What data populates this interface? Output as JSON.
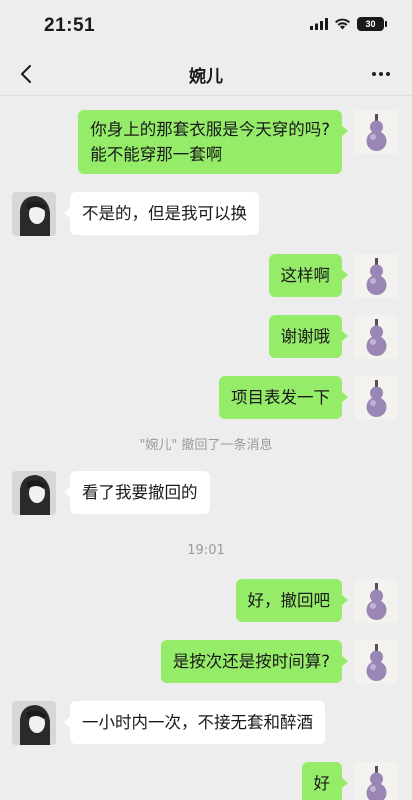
{
  "status_bar": {
    "time": "21:51",
    "battery": "30"
  },
  "header": {
    "title": "婉儿",
    "back_icon": "chevron-left-icon",
    "more_icon": "more-dots-icon"
  },
  "messages": [
    {
      "sender": "self",
      "text_lines": [
        "你身上的那套衣服是今天穿的吗?",
        "能不能穿那一套啊"
      ]
    },
    {
      "sender": "other",
      "text": "不是的，但是我可以换"
    },
    {
      "sender": "self",
      "text": "这样啊"
    },
    {
      "sender": "self",
      "text": "谢谢哦"
    },
    {
      "sender": "self",
      "text": "项目表发一下"
    },
    {
      "type": "system",
      "text": "\"婉儿\" 撤回了一条消息"
    },
    {
      "sender": "other",
      "text": "看了我要撤回的"
    },
    {
      "type": "timestamp",
      "text": "19:01"
    },
    {
      "sender": "self",
      "text": "好，撤回吧"
    },
    {
      "sender": "self",
      "text": "是按次还是按时间算?"
    },
    {
      "sender": "other",
      "text": "一小时内一次，不接无套和醉酒"
    },
    {
      "sender": "self",
      "text": "好"
    }
  ],
  "colors": {
    "self_bubble": "#95ec69",
    "other_bubble": "#ffffff",
    "background": "#ededed"
  }
}
